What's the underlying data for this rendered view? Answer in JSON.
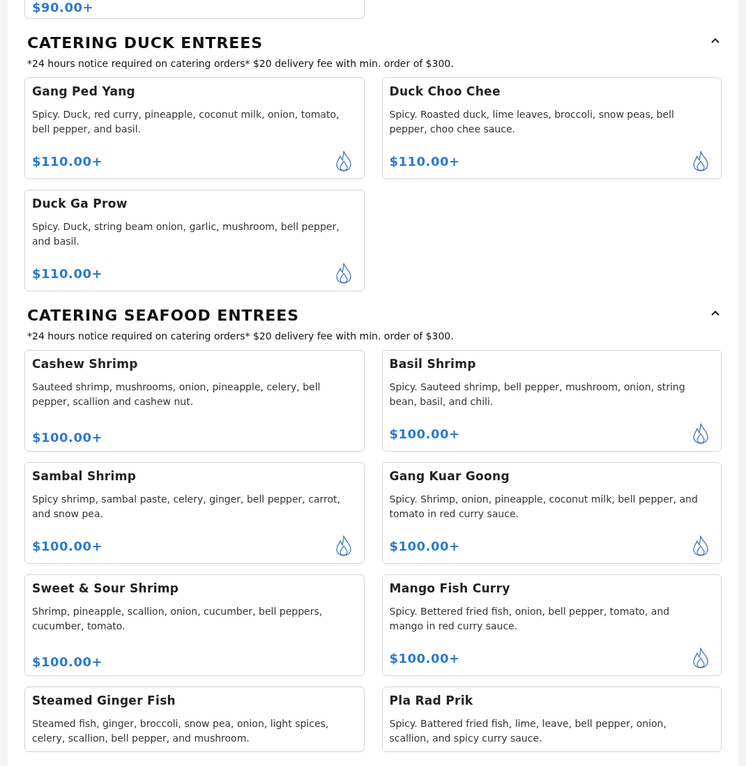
{
  "top_card": {
    "price": "$90.00+"
  },
  "sections": [
    {
      "title": "CATERING DUCK ENTREES",
      "expanded": true,
      "note": "*24 hours notice required on catering orders* $20 delivery fee with min. order of $300.",
      "items": [
        {
          "name": "Gang Ped Yang",
          "description": "Spicy. Duck, red curry, pineapple, coconut milk, onion, tomato, bell pepper, and basil.",
          "price": "$110.00+",
          "spicy": true
        },
        {
          "name": "Duck Choo Chee",
          "description": "Spicy. Roasted duck, lime leaves, broccoli, snow peas, bell pepper, choo chee sauce.",
          "price": "$110.00+",
          "spicy": true
        },
        {
          "name": "Duck Ga Prow",
          "description": "Spicy. Duck, string beam onion, garlic, mushroom, bell pepper, and basil.",
          "price": "$110.00+",
          "spicy": true
        }
      ]
    },
    {
      "title": "CATERING SEAFOOD ENTREES",
      "expanded": true,
      "note": "*24 hours notice required on catering orders* $20 delivery fee with min. order of $300.",
      "items": [
        {
          "name": "Cashew Shrimp",
          "description": "Sauteed shrimp, mushrooms, onion, pineapple, celery, bell pepper, scallion and cashew nut.",
          "price": "$100.00+",
          "spicy": false
        },
        {
          "name": "Basil Shrimp",
          "description": "Spicy. Sauteed shrimp, bell pepper, mushroom, onion, string bean, basil, and chili.",
          "price": "$100.00+",
          "spicy": true
        },
        {
          "name": "Sambal Shrimp",
          "description": "Spicy shrimp, sambal paste, celery, ginger, bell pepper, carrot, and snow pea.",
          "price": "$100.00+",
          "spicy": true
        },
        {
          "name": "Gang Kuar Goong",
          "description": "Spicy. Shrimp, onion, pineapple, coconut milk, bell pepper, and tomato in red curry sauce.",
          "price": "$100.00+",
          "spicy": true
        },
        {
          "name": "Sweet & Sour Shrimp",
          "description": "Shrimp, pineapple, scallion, onion, cucumber, bell peppers, cucumber, tomato.",
          "price": "$100.00+",
          "spicy": false
        },
        {
          "name": "Mango Fish Curry",
          "description": "Spicy. Bettered fried fish, onion, bell pepper, tomato, and mango in red curry sauce.",
          "price": "$100.00+",
          "spicy": true
        },
        {
          "name": "Steamed Ginger Fish",
          "description": "Steamed fish, ginger, broccoli, snow pea, onion, light spices, celery, scallion, bell pepper, and mushroom."
        },
        {
          "name": "Pla Rad Prik",
          "description": "Spicy. Battered fried fish, lime, leave, bell pepper, onion, scallion, and spicy curry sauce."
        }
      ]
    }
  ]
}
